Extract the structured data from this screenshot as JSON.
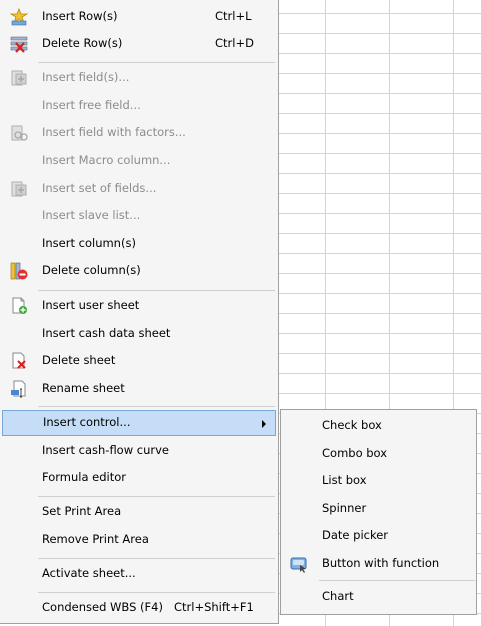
{
  "menu": {
    "items": [
      {
        "label": "Insert Row(s)",
        "shortcut": "Ctrl+L",
        "icon": "insert-row-icon",
        "disabled": false
      },
      {
        "label": "Delete Row(s)",
        "shortcut": "Ctrl+D",
        "icon": "delete-row-icon",
        "disabled": false
      },
      {
        "label": "Insert field(s)...",
        "icon": "insert-field-icon",
        "disabled": true
      },
      {
        "label": "Insert free field...",
        "disabled": true
      },
      {
        "label": "Insert field with factors...",
        "icon": "insert-field-factors-icon",
        "disabled": true
      },
      {
        "label": "Insert Macro column...",
        "disabled": true
      },
      {
        "label": "Insert set of fields...",
        "icon": "insert-set-of-fields-icon",
        "disabled": true
      },
      {
        "label": "Insert slave list...",
        "disabled": true
      },
      {
        "label": "Insert column(s)",
        "disabled": false
      },
      {
        "label": "Delete column(s)",
        "icon": "delete-column-icon",
        "disabled": false
      },
      {
        "label": "Insert user sheet",
        "icon": "insert-user-sheet-icon",
        "disabled": false
      },
      {
        "label": "Insert cash data sheet",
        "disabled": false
      },
      {
        "label": "Delete sheet",
        "icon": "delete-sheet-icon",
        "disabled": false
      },
      {
        "label": "Rename sheet",
        "icon": "rename-sheet-icon",
        "disabled": false
      },
      {
        "label": "Insert control...",
        "has_submenu": true,
        "highlighted": true
      },
      {
        "label": "Insert cash-flow curve",
        "disabled": false
      },
      {
        "label": "Formula editor",
        "disabled": false
      },
      {
        "label": "Set Print Area",
        "disabled": false
      },
      {
        "label": "Remove Print Area",
        "disabled": false
      },
      {
        "label": "Activate sheet...",
        "disabled": false
      },
      {
        "label": "Condensed WBS (F4)",
        "shortcut": "Ctrl+Shift+F1",
        "disabled": false
      }
    ]
  },
  "submenu": {
    "items": [
      {
        "label": "Check box"
      },
      {
        "label": "Combo box"
      },
      {
        "label": "List box"
      },
      {
        "label": "Spinner"
      },
      {
        "label": "Date picker"
      },
      {
        "label": "Button with function",
        "icon": "button-function-icon"
      },
      {
        "label": "Chart"
      }
    ]
  }
}
